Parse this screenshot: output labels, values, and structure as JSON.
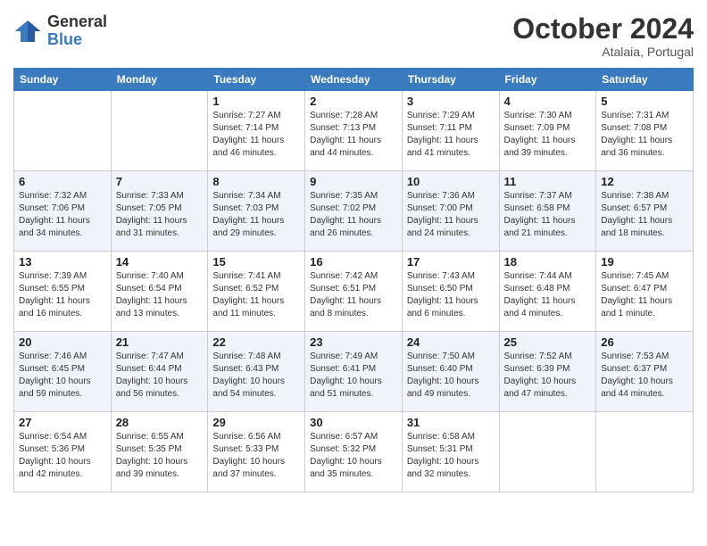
{
  "header": {
    "logo": {
      "general": "General",
      "blue": "Blue"
    },
    "title": "October 2024",
    "location": "Atalaia, Portugal"
  },
  "weekdays": [
    "Sunday",
    "Monday",
    "Tuesday",
    "Wednesday",
    "Thursday",
    "Friday",
    "Saturday"
  ],
  "weeks": [
    [
      {
        "day": "",
        "sunrise": "",
        "sunset": "",
        "daylight": ""
      },
      {
        "day": "",
        "sunrise": "",
        "sunset": "",
        "daylight": ""
      },
      {
        "day": "1",
        "sunrise": "Sunrise: 7:27 AM",
        "sunset": "Sunset: 7:14 PM",
        "daylight": "Daylight: 11 hours and 46 minutes."
      },
      {
        "day": "2",
        "sunrise": "Sunrise: 7:28 AM",
        "sunset": "Sunset: 7:13 PM",
        "daylight": "Daylight: 11 hours and 44 minutes."
      },
      {
        "day": "3",
        "sunrise": "Sunrise: 7:29 AM",
        "sunset": "Sunset: 7:11 PM",
        "daylight": "Daylight: 11 hours and 41 minutes."
      },
      {
        "day": "4",
        "sunrise": "Sunrise: 7:30 AM",
        "sunset": "Sunset: 7:09 PM",
        "daylight": "Daylight: 11 hours and 39 minutes."
      },
      {
        "day": "5",
        "sunrise": "Sunrise: 7:31 AM",
        "sunset": "Sunset: 7:08 PM",
        "daylight": "Daylight: 11 hours and 36 minutes."
      }
    ],
    [
      {
        "day": "6",
        "sunrise": "Sunrise: 7:32 AM",
        "sunset": "Sunset: 7:06 PM",
        "daylight": "Daylight: 11 hours and 34 minutes."
      },
      {
        "day": "7",
        "sunrise": "Sunrise: 7:33 AM",
        "sunset": "Sunset: 7:05 PM",
        "daylight": "Daylight: 11 hours and 31 minutes."
      },
      {
        "day": "8",
        "sunrise": "Sunrise: 7:34 AM",
        "sunset": "Sunset: 7:03 PM",
        "daylight": "Daylight: 11 hours and 29 minutes."
      },
      {
        "day": "9",
        "sunrise": "Sunrise: 7:35 AM",
        "sunset": "Sunset: 7:02 PM",
        "daylight": "Daylight: 11 hours and 26 minutes."
      },
      {
        "day": "10",
        "sunrise": "Sunrise: 7:36 AM",
        "sunset": "Sunset: 7:00 PM",
        "daylight": "Daylight: 11 hours and 24 minutes."
      },
      {
        "day": "11",
        "sunrise": "Sunrise: 7:37 AM",
        "sunset": "Sunset: 6:58 PM",
        "daylight": "Daylight: 11 hours and 21 minutes."
      },
      {
        "day": "12",
        "sunrise": "Sunrise: 7:38 AM",
        "sunset": "Sunset: 6:57 PM",
        "daylight": "Daylight: 11 hours and 18 minutes."
      }
    ],
    [
      {
        "day": "13",
        "sunrise": "Sunrise: 7:39 AM",
        "sunset": "Sunset: 6:55 PM",
        "daylight": "Daylight: 11 hours and 16 minutes."
      },
      {
        "day": "14",
        "sunrise": "Sunrise: 7:40 AM",
        "sunset": "Sunset: 6:54 PM",
        "daylight": "Daylight: 11 hours and 13 minutes."
      },
      {
        "day": "15",
        "sunrise": "Sunrise: 7:41 AM",
        "sunset": "Sunset: 6:52 PM",
        "daylight": "Daylight: 11 hours and 11 minutes."
      },
      {
        "day": "16",
        "sunrise": "Sunrise: 7:42 AM",
        "sunset": "Sunset: 6:51 PM",
        "daylight": "Daylight: 11 hours and 8 minutes."
      },
      {
        "day": "17",
        "sunrise": "Sunrise: 7:43 AM",
        "sunset": "Sunset: 6:50 PM",
        "daylight": "Daylight: 11 hours and 6 minutes."
      },
      {
        "day": "18",
        "sunrise": "Sunrise: 7:44 AM",
        "sunset": "Sunset: 6:48 PM",
        "daylight": "Daylight: 11 hours and 4 minutes."
      },
      {
        "day": "19",
        "sunrise": "Sunrise: 7:45 AM",
        "sunset": "Sunset: 6:47 PM",
        "daylight": "Daylight: 11 hours and 1 minute."
      }
    ],
    [
      {
        "day": "20",
        "sunrise": "Sunrise: 7:46 AM",
        "sunset": "Sunset: 6:45 PM",
        "daylight": "Daylight: 10 hours and 59 minutes."
      },
      {
        "day": "21",
        "sunrise": "Sunrise: 7:47 AM",
        "sunset": "Sunset: 6:44 PM",
        "daylight": "Daylight: 10 hours and 56 minutes."
      },
      {
        "day": "22",
        "sunrise": "Sunrise: 7:48 AM",
        "sunset": "Sunset: 6:43 PM",
        "daylight": "Daylight: 10 hours and 54 minutes."
      },
      {
        "day": "23",
        "sunrise": "Sunrise: 7:49 AM",
        "sunset": "Sunset: 6:41 PM",
        "daylight": "Daylight: 10 hours and 51 minutes."
      },
      {
        "day": "24",
        "sunrise": "Sunrise: 7:50 AM",
        "sunset": "Sunset: 6:40 PM",
        "daylight": "Daylight: 10 hours and 49 minutes."
      },
      {
        "day": "25",
        "sunrise": "Sunrise: 7:52 AM",
        "sunset": "Sunset: 6:39 PM",
        "daylight": "Daylight: 10 hours and 47 minutes."
      },
      {
        "day": "26",
        "sunrise": "Sunrise: 7:53 AM",
        "sunset": "Sunset: 6:37 PM",
        "daylight": "Daylight: 10 hours and 44 minutes."
      }
    ],
    [
      {
        "day": "27",
        "sunrise": "Sunrise: 6:54 AM",
        "sunset": "Sunset: 5:36 PM",
        "daylight": "Daylight: 10 hours and 42 minutes."
      },
      {
        "day": "28",
        "sunrise": "Sunrise: 6:55 AM",
        "sunset": "Sunset: 5:35 PM",
        "daylight": "Daylight: 10 hours and 39 minutes."
      },
      {
        "day": "29",
        "sunrise": "Sunrise: 6:56 AM",
        "sunset": "Sunset: 5:33 PM",
        "daylight": "Daylight: 10 hours and 37 minutes."
      },
      {
        "day": "30",
        "sunrise": "Sunrise: 6:57 AM",
        "sunset": "Sunset: 5:32 PM",
        "daylight": "Daylight: 10 hours and 35 minutes."
      },
      {
        "day": "31",
        "sunrise": "Sunrise: 6:58 AM",
        "sunset": "Sunset: 5:31 PM",
        "daylight": "Daylight: 10 hours and 32 minutes."
      },
      {
        "day": "",
        "sunrise": "",
        "sunset": "",
        "daylight": ""
      },
      {
        "day": "",
        "sunrise": "",
        "sunset": "",
        "daylight": ""
      }
    ]
  ]
}
